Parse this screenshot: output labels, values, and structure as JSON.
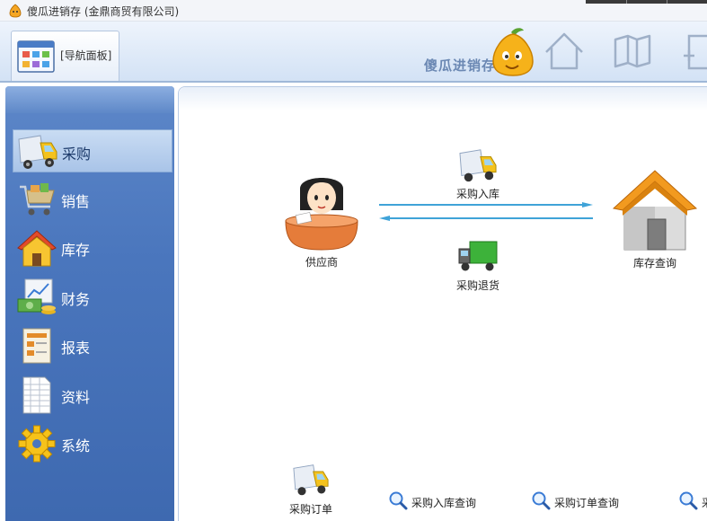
{
  "window": {
    "title": "傻瓜进销存 (金鼎商贸有限公司)"
  },
  "toolbar": {
    "nav_tab_label": "[导航面板]",
    "brand_text": "傻瓜进销存"
  },
  "sidebar": {
    "items": [
      {
        "label": "采购",
        "icon": "truck-icon",
        "active": true
      },
      {
        "label": "销售",
        "icon": "shopping-cart-icon",
        "active": false
      },
      {
        "label": "库存",
        "icon": "house-icon",
        "active": false
      },
      {
        "label": "财务",
        "icon": "money-chart-icon",
        "active": false
      },
      {
        "label": "报表",
        "icon": "report-icon",
        "active": false
      },
      {
        "label": "资料",
        "icon": "spreadsheet-icon",
        "active": false
      },
      {
        "label": "系统",
        "icon": "gear-icon",
        "active": false
      }
    ]
  },
  "flow": {
    "supplier_label": "供应商",
    "purchase_in_label": "采购入库",
    "purchase_return_label": "采购退货",
    "inventory_query_label": "库存查询",
    "purchase_order_label": "采购订单"
  },
  "queries": {
    "in_query_label": "采购入库查询",
    "order_query_label": "采购订单查询",
    "partial_label": "采"
  },
  "colors": {
    "sidebar_blue": "#4a76bd",
    "arrow_blue": "#3fa3d8",
    "accent_orange": "#f29a1f"
  }
}
